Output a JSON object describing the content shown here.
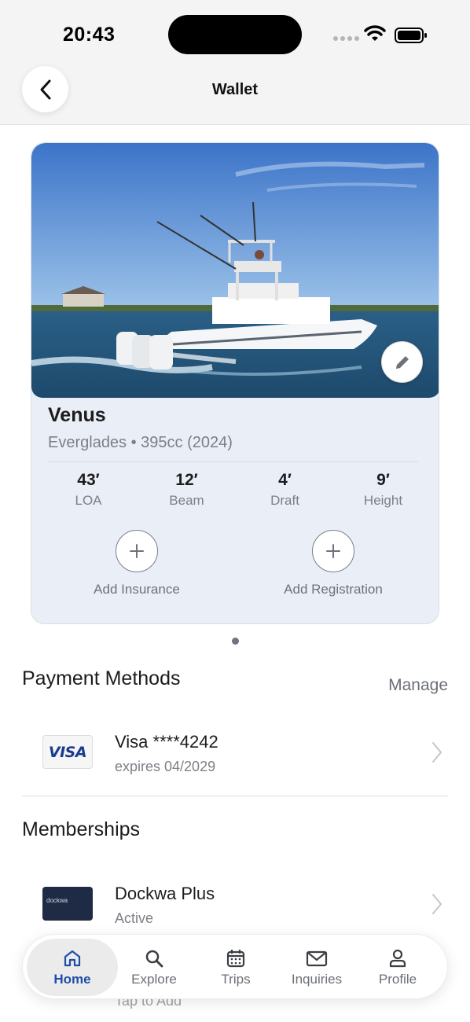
{
  "status_bar": {
    "time": "20:43"
  },
  "header": {
    "title": "Wallet"
  },
  "vessel": {
    "name": "Venus",
    "subtitle": "Everglades • 395cc (2024)",
    "specs": [
      {
        "value": "43′",
        "label": "LOA"
      },
      {
        "value": "12′",
        "label": "Beam"
      },
      {
        "value": "4′",
        "label": "Draft"
      },
      {
        "value": "9′",
        "label": "Height"
      }
    ],
    "actions": {
      "insurance": "Add Insurance",
      "registration": "Add Registration"
    }
  },
  "payment": {
    "title": "Payment Methods",
    "manage": "Manage",
    "card": {
      "brand_logo": "VISA",
      "title": "Visa ****4242",
      "subtitle": "expires 04/2029"
    }
  },
  "memberships": {
    "title": "Memberships",
    "item": {
      "logo_text": "dockwa",
      "title": "Dockwa Plus",
      "subtitle": "Active"
    },
    "ghost": "Tap to Add"
  },
  "tabs": [
    {
      "label": "Home",
      "icon": "home-icon",
      "active": true
    },
    {
      "label": "Explore",
      "icon": "search-icon"
    },
    {
      "label": "Trips",
      "icon": "calendar-icon"
    },
    {
      "label": "Inquiries",
      "icon": "mail-icon"
    },
    {
      "label": "Profile",
      "icon": "profile-icon"
    }
  ],
  "colors": {
    "accent": "#1e4ea8",
    "card_bg": "#eaeef6",
    "muted": "#7c7f86"
  }
}
